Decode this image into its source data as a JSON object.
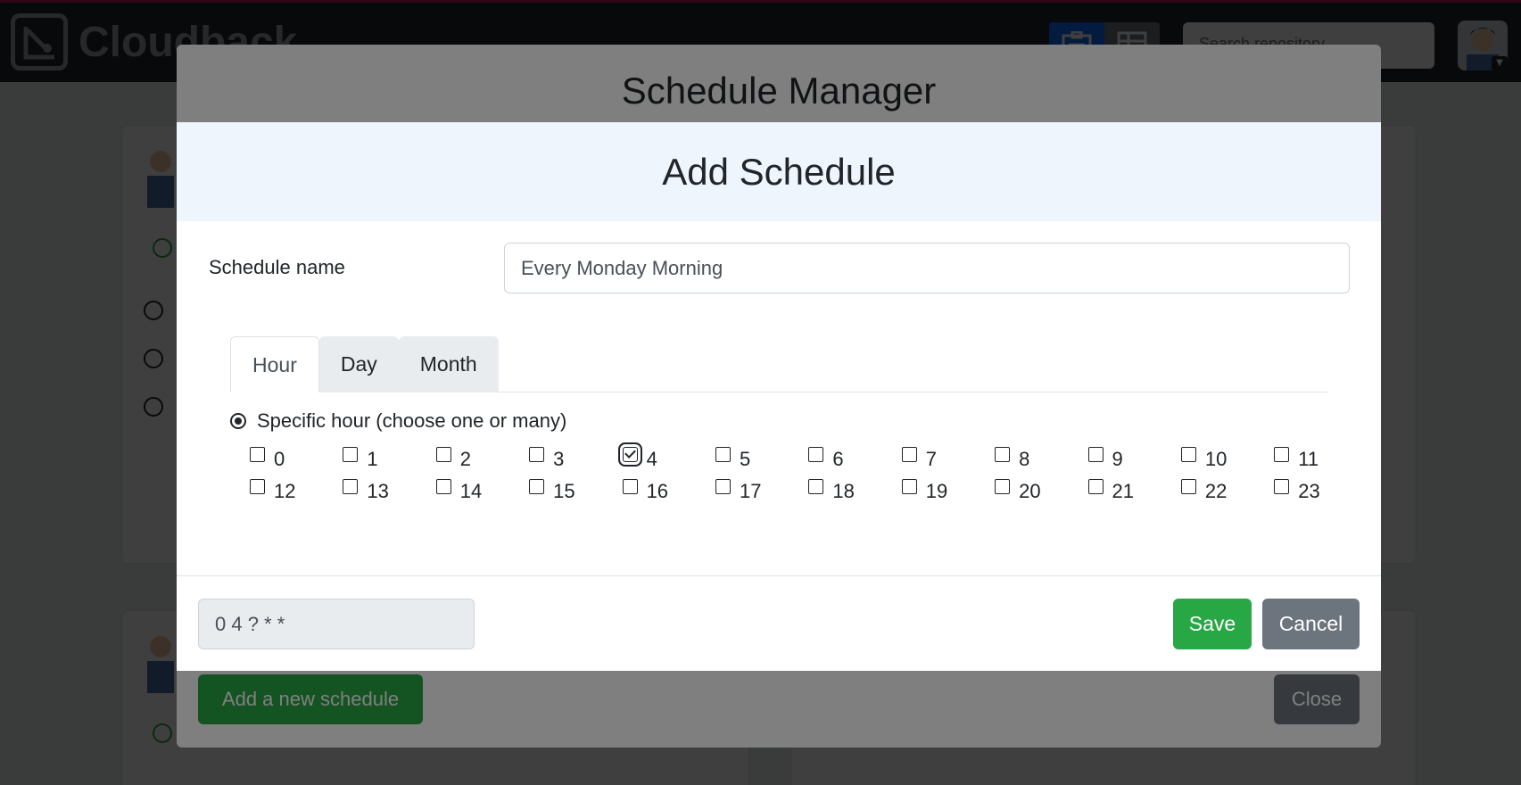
{
  "app": {
    "brand": "Cloudback",
    "search_placeholder": "Search repository"
  },
  "manager": {
    "title": "Schedule Manager",
    "add_button": "Add a new schedule",
    "close_button": "Close"
  },
  "add_schedule": {
    "title": "Add Schedule",
    "name_label": "Schedule name",
    "name_value": "Every Monday Morning",
    "tabs": [
      {
        "label": "Hour",
        "active": true
      },
      {
        "label": "Day",
        "active": false
      },
      {
        "label": "Month",
        "active": false
      }
    ],
    "radio_label": "Specific hour (choose one or many)",
    "hours": [
      "0",
      "1",
      "2",
      "3",
      "4",
      "5",
      "6",
      "7",
      "8",
      "9",
      "10",
      "11",
      "12",
      "13",
      "14",
      "15",
      "16",
      "17",
      "18",
      "19",
      "20",
      "21",
      "22",
      "23"
    ],
    "checked_hours": [
      "4"
    ],
    "cron_value": "0 4 ? * *",
    "save_button": "Save",
    "cancel_button": "Cancel"
  },
  "colors": {
    "success": "#28a745",
    "secondary": "#6c757d",
    "primary": "#0d6efd",
    "header_bg": "#eef5fd"
  }
}
